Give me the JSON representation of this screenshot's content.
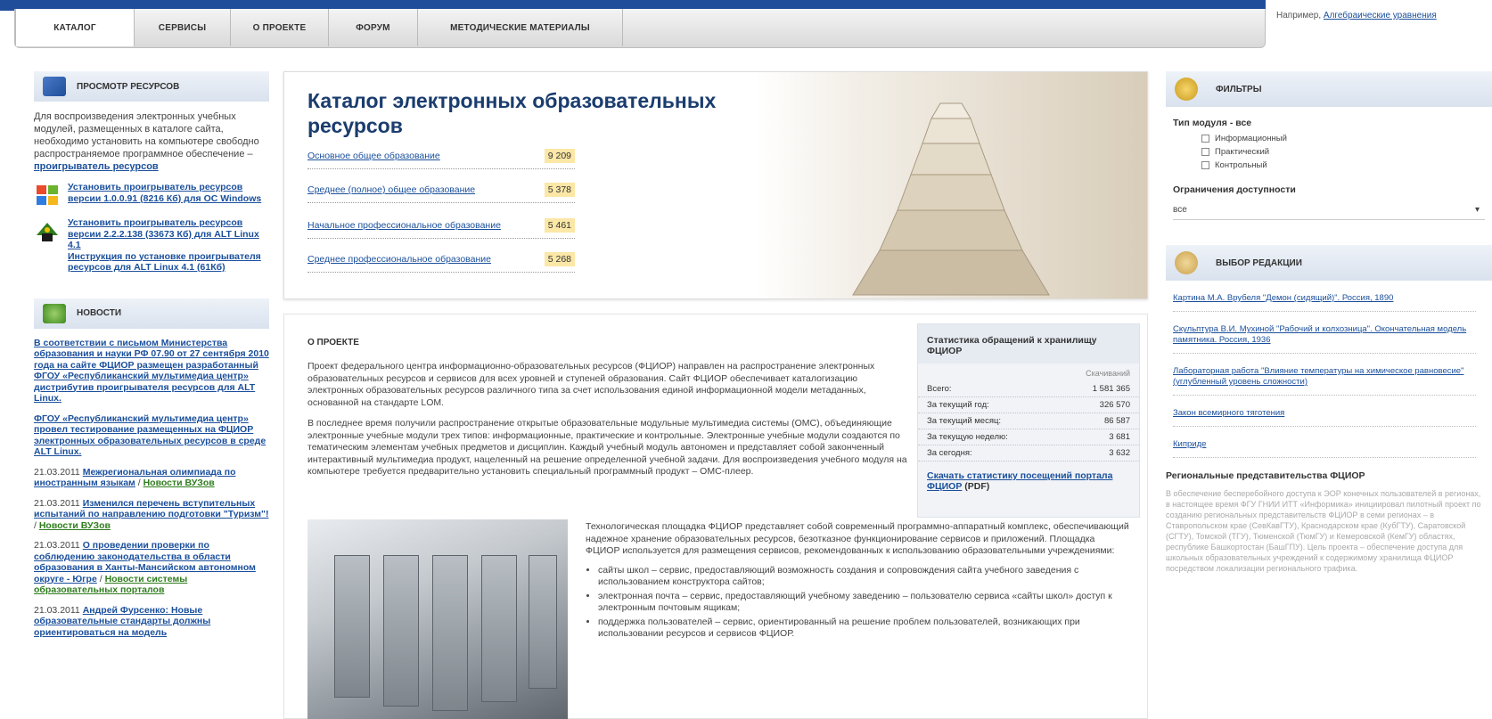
{
  "nav": {
    "tabs": [
      "КАТАЛОГ",
      "СЕРВИСЫ",
      "О ПРОЕКТЕ",
      "ФОРУМ",
      "МЕТОДИЧЕСКИЕ МАТЕРИАЛЫ"
    ],
    "active_tab": "КАТАЛОГ",
    "hint_prefix": "Например,",
    "hint_link": "Алгебраические уравнения"
  },
  "left": {
    "view": {
      "title": "ПРОСМОТР РЕСУРСОВ",
      "text": "Для воспроизведения электронных учебных модулей, размещенных в каталоге сайта, необходимо установить на компьютере свободно распространяемое программное обеспечение –",
      "text_link": "проигрыватель ресурсов",
      "dl1": "Установить проигрыватель ресурсов версии 1.0.0.91 (8216 Кб) для ОС Windows",
      "dl2": "Установить проигрыватель ресурсов версии 2.2.2.138 (33673 Кб) для ALT Linux 4.1",
      "dl3": "Инструкция по установке проигрывателя ресурсов для ALT Linux 4.1 (61Кб)"
    },
    "news": {
      "title": "НОВОСТИ",
      "items": [
        {
          "date": "",
          "text": "В соответствии с письмом Министерства образования и науки РФ 07.90 от 27 сентября 2010 года на сайте ФЦИОР размещен разработанный ФГОУ «Республиканский мультимедиа центр» дистрибутив проигрывателя ресурсов для ALT Linux.",
          "tag": ""
        },
        {
          "date": "",
          "text": "ФГОУ «Республиканский мультимедиа центр» провел тестирование размещенных на ФЦИОР электронных образовательных ресурсов в среде ALT Linux.",
          "tag": ""
        },
        {
          "date": "21.03.2011",
          "text": "Межрегиональная олимпиада по иностранным языкам",
          "tag": "Новости ВУЗов"
        },
        {
          "date": "21.03.2011",
          "text": "Изменился перечень вступительных испытаний по направлению подготовки \"Туризм\"!",
          "tag": "Новости ВУЗов"
        },
        {
          "date": "21.03.2011",
          "text": "О проведении проверки по соблюдению законодательства в области образования в Ханты-Мансийском автономном округе - Югре",
          "tag": "Новости системы образовательных порталов"
        },
        {
          "date": "21.03.2011",
          "text": "Андрей Фурсенко: Новые образовательные стандарты должны ориентироваться на модель",
          "tag": ""
        }
      ]
    }
  },
  "catalog": {
    "title": "Каталог электронных образовательных ресурсов",
    "rows": [
      {
        "label": "Основное общее образование",
        "count": "9 209"
      },
      {
        "label": "Среднее (полное) общее образование",
        "count": "5 378"
      },
      {
        "label": "Начальное профессиональное образование",
        "count": "5 461"
      },
      {
        "label": "Среднее профессиональное образование",
        "count": "5 268"
      }
    ]
  },
  "about": {
    "title": "О ПРОЕКТЕ",
    "p1": "Проект федерального центра информационно-образовательных ресурсов (ФЦИОР) направлен на распространение электронных образовательных ресурсов и сервисов для всех уровней и ступеней образования. Сайт ФЦИОР обеспечивает каталогизацию электронных образовательных ресурсов различного типа за счет использования единой информационной модели метаданных, основанной на стандарте LOM.",
    "p2": "В последнее время получили распространение открытые образовательные модульные мультимедиа системы (ОМС), объединяющие электронные учебные модули трех типов: информационные, практические и контрольные. Электронные учебные модули создаются по тематическим элементам учебных предметов и дисциплин. Каждый учебный модуль автономен и представляет собой законченный интерактивный мультимедиа продукт, нацеленный на решение определенной учебной задачи. Для воспроизведения учебного модуля на компьютере требуется предварительно установить специальный программный продукт – ОМС-плеер.",
    "tech_intro": "Технологическая площадка ФЦИОР представляет собой современный программно-аппаратный комплекс, обеспечивающий надежное хранение образовательных ресурсов, безотказное функционирование сервисов и приложений. Площадка ФЦИОР используется для размещения сервисов, рекомендованных к использованию образовательными учреждениями:",
    "bullets": [
      "сайты школ – сервис, предоставляющий возможность создания и сопровождения сайта учебного заведения с использованием конструктора сайтов;",
      "электронная почта – сервис, предоставляющий учебному заведению – пользователю сервиса «сайты школ» доступ к электронным почтовым ящикам;",
      "поддержка пользователей – сервис, ориентированный на решение проблем пользователей, возникающих при использовании ресурсов и сервисов ФЦИОР."
    ]
  },
  "stats": {
    "title": "Статистика обращений к хранилищу ФЦИОР",
    "col": "Скачиваний",
    "rows": [
      {
        "label": "Всего:",
        "value": "1 581 365"
      },
      {
        "label": "За текущий год:",
        "value": "326 570"
      },
      {
        "label": "За текущий месяц:",
        "value": "86 587"
      },
      {
        "label": "За текущую неделю:",
        "value": "3 681"
      },
      {
        "label": "За сегодня:",
        "value": "3 632"
      }
    ],
    "link": "Скачать статистику посещений портала ФЦИОР",
    "link_suffix": "(PDF)"
  },
  "right": {
    "filters": {
      "title": "ФИЛЬТРЫ",
      "type_label": "Тип модуля - все",
      "types": [
        "Информационный",
        "Практический",
        "Контрольный"
      ],
      "access_label": "Ограничения доступности",
      "access_value": "все",
      "access_arrow": "▾"
    },
    "editors": {
      "title": "ВЫБОР РЕДАКЦИИ",
      "items": [
        "Картина М.А. Врубеля \"Демон (сидящий)\". Россия, 1890",
        "Скульптура В.И. Мухиной \"Рабочий и колхозница\". Окончательная модель памятника. Россия, 1936",
        "Лабораторная работа \"Влияние температуры на химическое равновесие\" (углубленный уровень сложности)",
        "Закон всемирного тяготения",
        "Киприде"
      ]
    },
    "regional": {
      "title": "Региональные представительства ФЦИОР",
      "text": "В обеспечение бесперебойного доступа к ЭОР конечных пользователей в регионах, в настоящее время ФГУ ГНИИ ИТТ «Информика» инициировал пилотный проект по созданию региональных представительств ФЦИОР в семи регионах – в Ставропольском крае (СевКавГТУ), Краснодарском крае (КубГТУ), Саратовской (СГТУ), Томской (ТГУ), Тюменской (ТюмГУ) и Кемеровской (КемГУ) областях, республике Башкортостан (БашГПУ). Цель проекта – обеспечение доступа для школьных образовательных учреждений к содержимому хранилища ФЦИОР посредством локализации регионального трафика."
    }
  },
  "colors": {
    "brand_blue": "#1f4d9a",
    "link": "#1a4f9c",
    "count_highlight": "#fbe7a6",
    "news_green": "#2f7d1e"
  },
  "icons": [
    "windows-icon",
    "linux-icon",
    "catalog-book-icon",
    "news-icon",
    "filter-icon",
    "editor-icon"
  ]
}
